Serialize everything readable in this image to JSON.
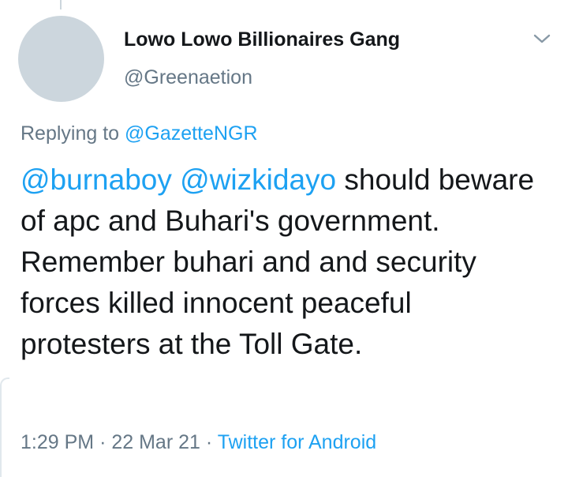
{
  "tweet": {
    "author": {
      "display_name": "Lowo Lowo Billionaires Gang",
      "handle": "@Greenaetion"
    },
    "reply": {
      "prefix": "Replying to",
      "to": "@GazetteNGR"
    },
    "mentions": [
      "@burnaboy",
      "@wizkidayo"
    ],
    "body": "should beware of apc and Buhari's government. Remember buhari and and security forces killed innocent peaceful protesters at the Toll Gate.",
    "time": "1:29 PM",
    "separator": "·",
    "date": "22 Mar 21",
    "source": "Twitter for Android"
  },
  "icons": {
    "menu": "chevron-down-icon"
  },
  "colors": {
    "text": "#14171a",
    "secondary": "#657786",
    "link": "#1da1f2",
    "avatar_placeholder": "#ccd6dd"
  }
}
